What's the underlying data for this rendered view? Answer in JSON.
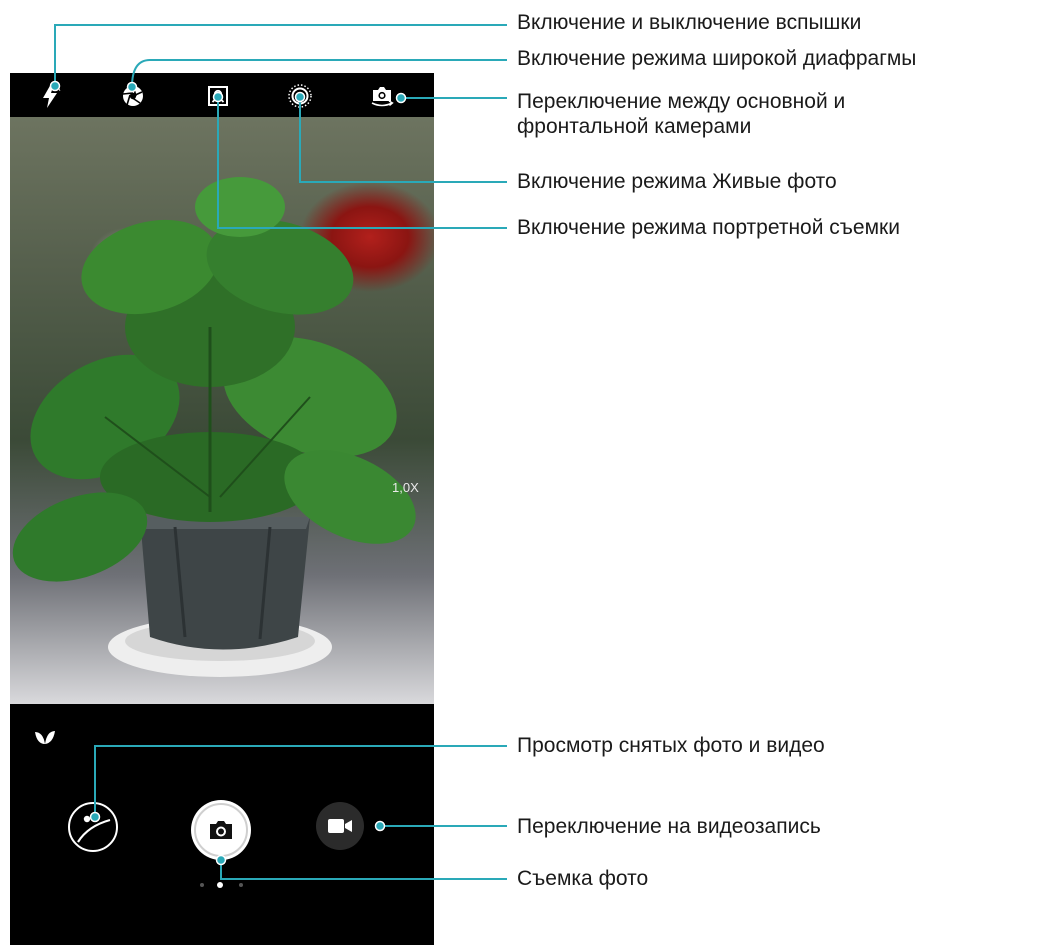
{
  "camera": {
    "zoom_level": "1,0X"
  },
  "top_icons": [
    "flash-auto-icon",
    "aperture-icon",
    "portrait-icon",
    "live-photo-icon",
    "switch-camera-icon"
  ],
  "bottom_icons": [
    "leaf-icon",
    "gallery-icon",
    "shutter-icon",
    "video-icon"
  ],
  "pager": {
    "count": 3,
    "active": 2
  },
  "annotations": {
    "flash": "Включение и выключение вспышки",
    "aperture": "Включение режима широкой диафрагмы",
    "switch_camera_line1": "Переключение между основной и",
    "switch_camera_line2": "фронтальной камерами",
    "live_photo": "Включение режима Живые фото",
    "portrait": "Включение режима портретной съемки",
    "gallery": "Просмотр снятых фото и видео",
    "video": "Переключение на видеозапись",
    "shutter": "Съемка фото"
  },
  "colors": {
    "callout_line": "#2aa9b8",
    "bar_bg": "#000000",
    "label_text": "#1a1a1a"
  }
}
